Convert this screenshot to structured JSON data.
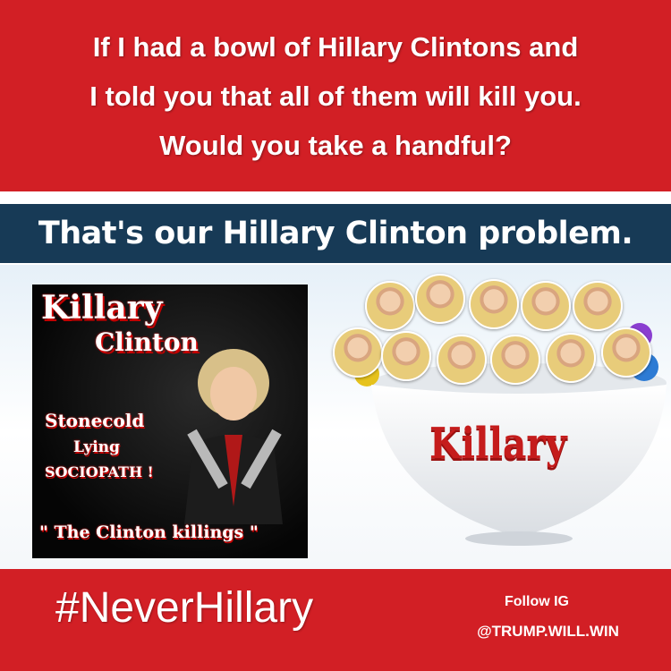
{
  "header": {
    "lines": [
      "If I had a bowl of Hillary Clintons and",
      "I told you that all of them will kill you.",
      "Would you take a handful?"
    ],
    "color": "#d21f25"
  },
  "band": {
    "text": "That's our Hillary Clinton problem.",
    "color": "#173a56"
  },
  "poster": {
    "title1": "Killary",
    "title2": "Clinton",
    "line1": "Stonecold",
    "line2": "Lying",
    "line3": "SOCIOPATH !",
    "quote": "\" The Clinton killings \""
  },
  "bowl": {
    "label": "Killary",
    "label_color": "#c51c1c"
  },
  "footer": {
    "hashtag": "#NeverHillary",
    "follow_line1": "Follow IG",
    "follow_line2": "@TRUMP.WILL.WIN"
  }
}
